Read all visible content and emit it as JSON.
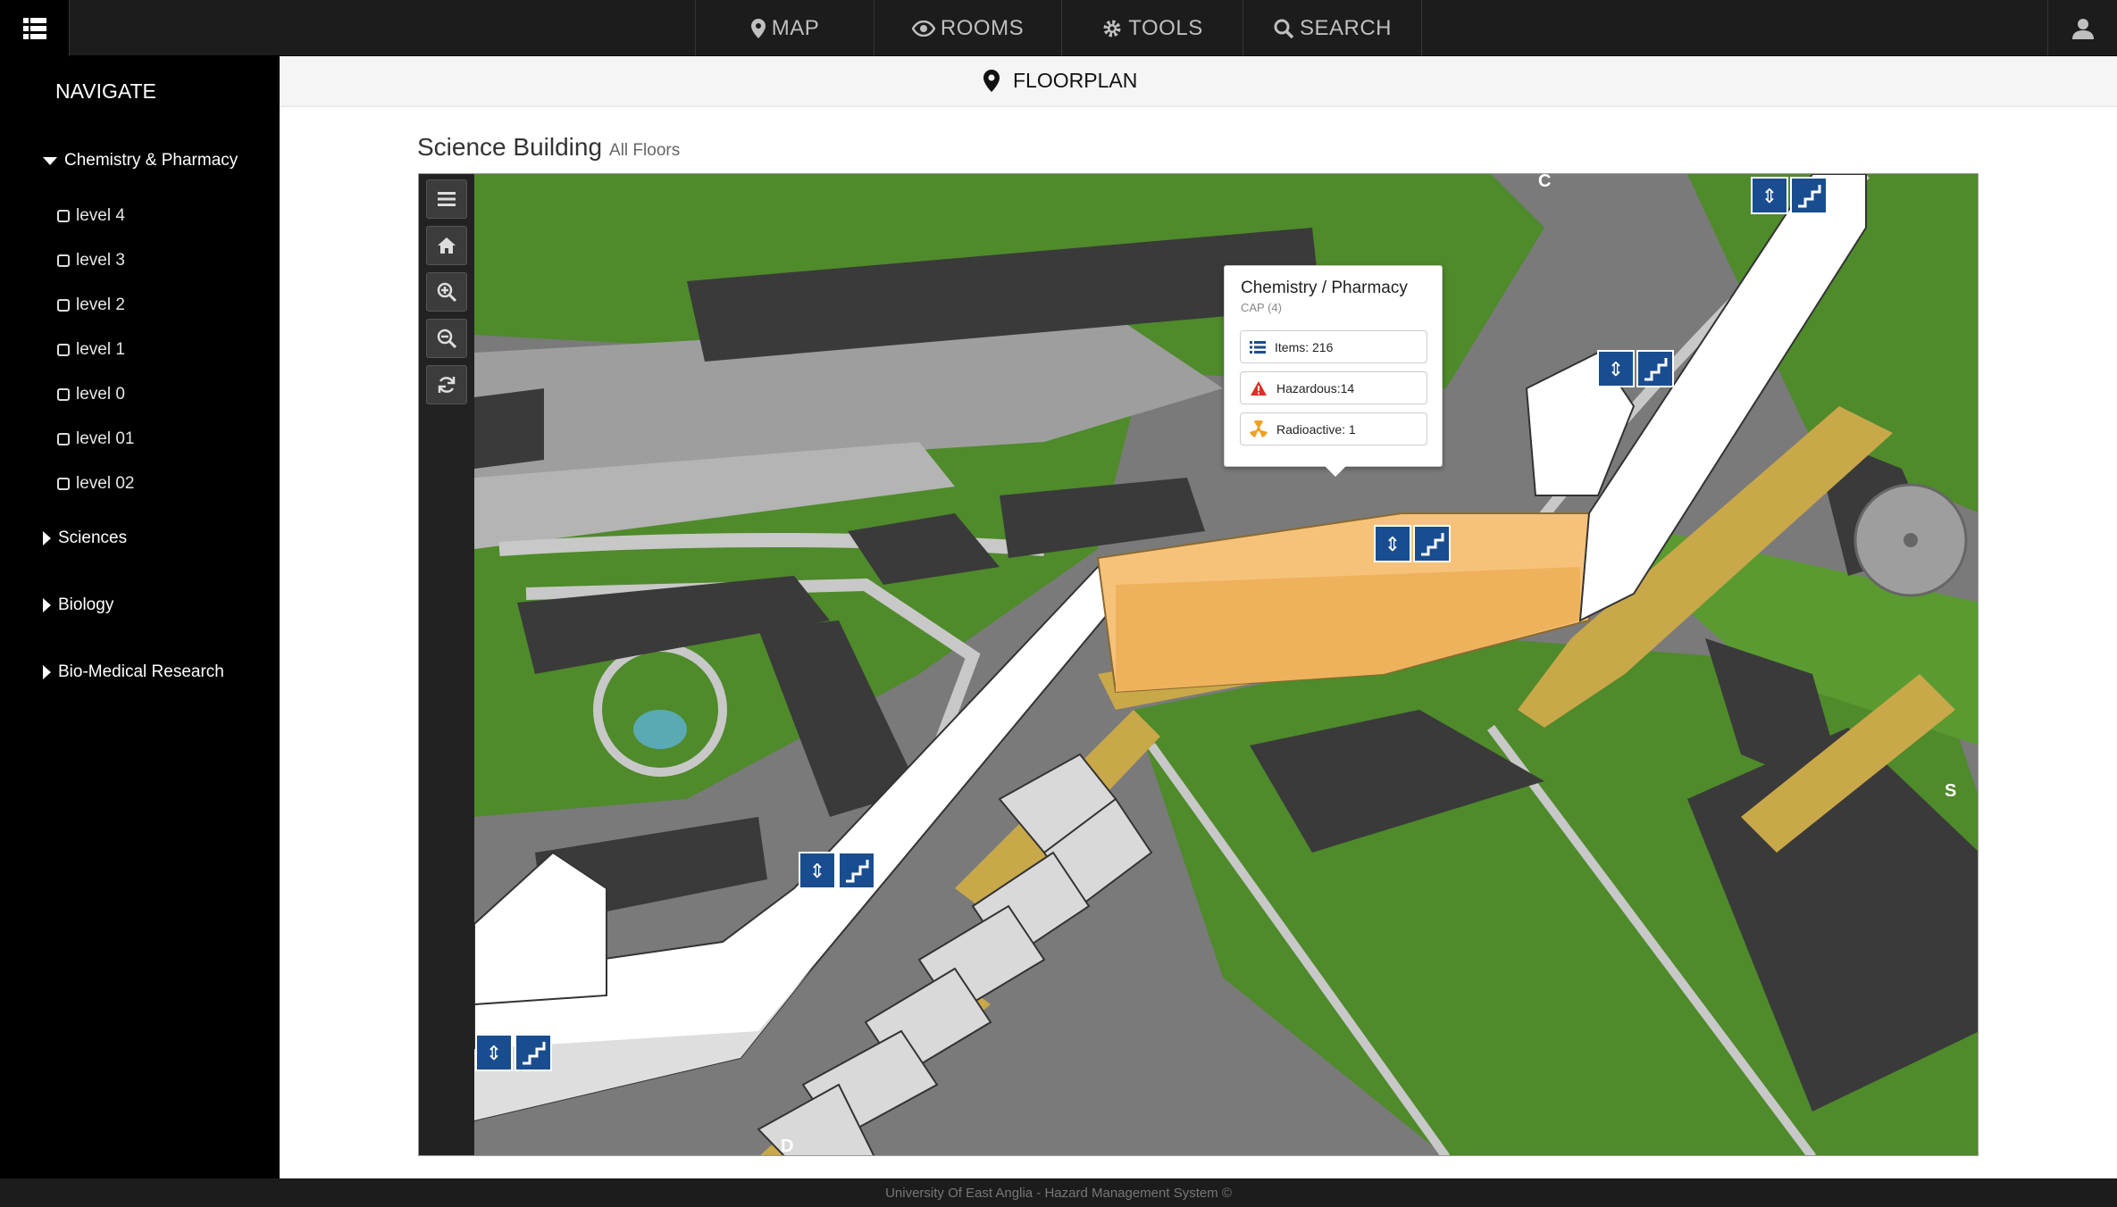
{
  "topbar": {
    "nav": [
      {
        "label": "MAP",
        "icon": "map-marker-icon"
      },
      {
        "label": "ROOMS",
        "icon": "eye-icon"
      },
      {
        "label": "TOOLS",
        "icon": "gear-icon"
      },
      {
        "label": "SEARCH",
        "icon": "search-icon"
      }
    ],
    "menu_icon": "grid-menu-icon",
    "user_icon": "user-icon"
  },
  "sidebar": {
    "title": "NAVIGATE",
    "groups": [
      {
        "label": "Chemistry & Pharmacy",
        "expanded": true,
        "levels": [
          "level 4",
          "level 3",
          "level 2",
          "level 1",
          "level 0",
          "level 01",
          "level 02"
        ]
      },
      {
        "label": "Sciences",
        "expanded": false
      },
      {
        "label": "Biology",
        "expanded": false
      },
      {
        "label": "Bio-Medical Research",
        "expanded": false
      }
    ]
  },
  "header": {
    "title": "FLOORPLAN",
    "icon": "map-marker-icon"
  },
  "page": {
    "title": "Science Building",
    "subtitle": "All Floors"
  },
  "map_tools": [
    "menu-icon",
    "home-icon",
    "zoom-in-icon",
    "zoom-out-icon",
    "refresh-icon"
  ],
  "popup": {
    "title": "Chemistry / Pharmacy",
    "subtitle": "CAP (4)",
    "items": [
      {
        "label": "Items: 216",
        "icon": "list-icon"
      },
      {
        "label": "Hazardous:14",
        "icon": "warning-icon"
      },
      {
        "label": "Radioactive: 1",
        "icon": "radioactive-icon"
      }
    ]
  },
  "map": {
    "road_labels": [
      "C",
      "S",
      "D"
    ],
    "colors": {
      "grass": "#4f8a2b",
      "path": "#b8b8b8",
      "building": "#ffffff",
      "highlight": "#f6c27a",
      "ramp": "#c9a84a",
      "roof": "#3a3a3a",
      "sign": "#1a4d8f"
    }
  },
  "footer": {
    "text": "University Of East Anglia - Hazard Management System ©"
  }
}
